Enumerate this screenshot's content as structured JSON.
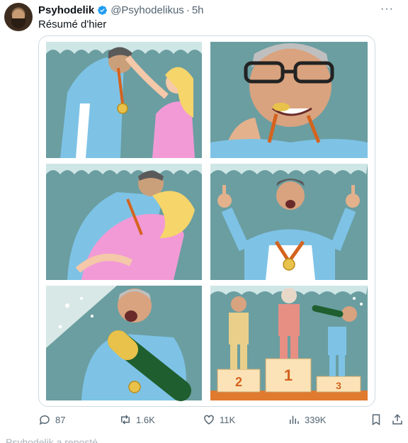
{
  "tweet": {
    "author_name": "Psyhodelik",
    "handle": "@Psyhodelikus",
    "separator": "·",
    "time": "5h",
    "text": "Résumé d'hier",
    "more_label": "···"
  },
  "image": {
    "podium_numbers": [
      "2",
      "1",
      "3"
    ],
    "description_icons": [
      "medal-ceremony-panel",
      "medal-bite-panel",
      "kiss-panel",
      "middle-fingers-panel",
      "champagne-panel",
      "podium-panel"
    ]
  },
  "actions": {
    "replies": "87",
    "reposts": "1.6K",
    "likes": "11K",
    "views": "339K"
  },
  "colors": {
    "accent": "#1d9bf0",
    "text_secondary": "#536471",
    "panel_bg": "#6b9ea1"
  },
  "next_tweet_partial": "Psyhodelik a reposté"
}
